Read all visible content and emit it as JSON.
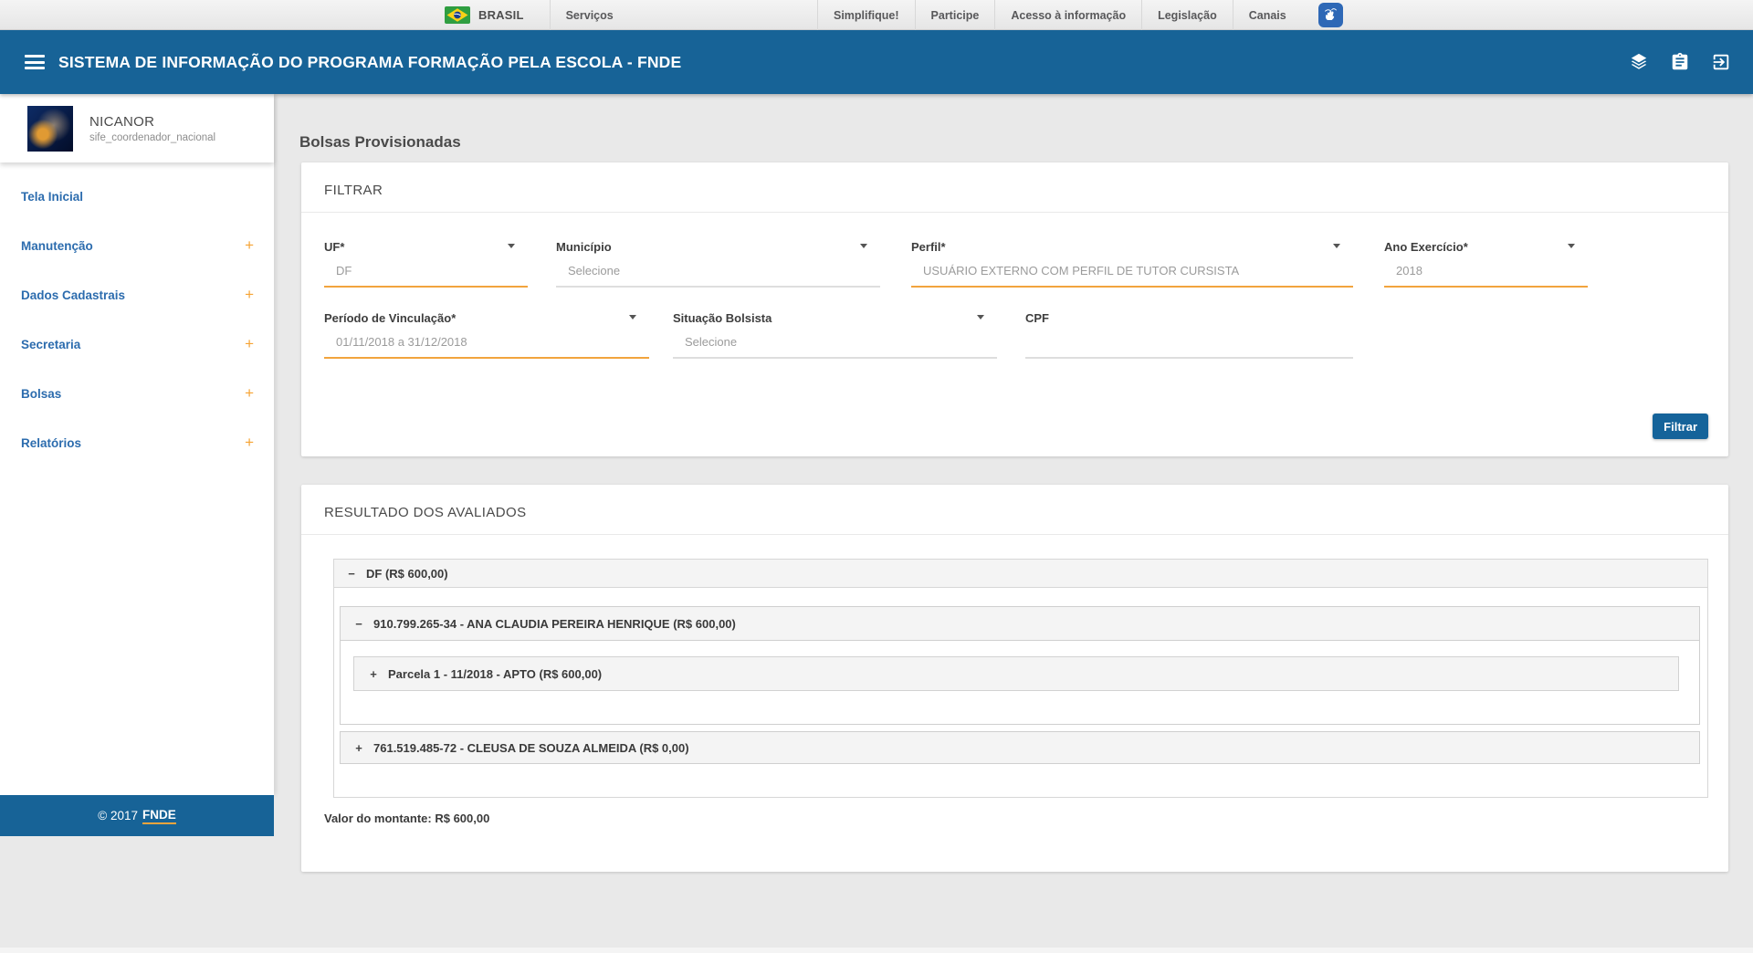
{
  "govbar": {
    "brand": "BRASIL",
    "services_label": "Serviços",
    "right_items": [
      "Simplifique!",
      "Participe",
      "Acesso à informação",
      "Legislação",
      "Canais"
    ]
  },
  "header": {
    "title": "SISTEMA DE INFORMAÇÃO DO PROGRAMA FORMAÇÃO PELA ESCOLA - FNDE"
  },
  "sidebar": {
    "user": {
      "name": "NICANOR",
      "role": "sife_coordenador_nacional"
    },
    "expand_icon": "+",
    "items": [
      {
        "label": "Tela Inicial"
      },
      {
        "label": "Manutenção"
      },
      {
        "label": "Dados Cadastrais"
      },
      {
        "label": "Secretaria"
      },
      {
        "label": "Bolsas"
      },
      {
        "label": "Relatórios"
      }
    ],
    "footer": {
      "copyright": "© 2017",
      "link": "FNDE"
    }
  },
  "page": {
    "title": "Bolsas Provisionadas"
  },
  "filter": {
    "heading": "FILTRAR",
    "fields": [
      {
        "label": "UF*",
        "value": "DF"
      },
      {
        "label": "Município",
        "value": "Selecione"
      },
      {
        "label": "Perfil*",
        "value": "USUÁRIO EXTERNO COM PERFIL DE TUTOR CURSISTA"
      },
      {
        "label": "Ano Exercício*",
        "value": "2018"
      },
      {
        "label": "Período de Vinculação*",
        "value": "01/11/2018 a 31/12/2018"
      },
      {
        "label": "Situação Bolsista",
        "value": "Selecione"
      },
      {
        "label": "CPF",
        "value": ""
      }
    ],
    "submit_label": "Filtrar"
  },
  "results": {
    "heading": "RESULTADO DOS AVALIADOS",
    "tree": {
      "group": {
        "toggle": "−",
        "label": "DF (R$ 600,00)"
      },
      "item1": {
        "toggle": "−",
        "label": "910.799.265-34 - ANA CLAUDIA PEREIRA HENRIQUE (R$ 600,00)"
      },
      "item1_child": {
        "toggle": "+",
        "label": "Parcela 1 - 11/2018 - APTO (R$ 600,00)"
      },
      "item2": {
        "toggle": "+",
        "label": "761.519.485-72 - CLEUSA DE SOUZA ALMEIDA (R$ 0,00)"
      }
    },
    "total": "Valor do montante: R$ 600,00"
  },
  "colors": {
    "primary_blue": "#176397",
    "accent_orange": "#f2a43d",
    "sidebar_link_blue": "#2c6cae",
    "vlibras_blue": "#2e68b6",
    "page_background": "#e9e9e9"
  }
}
